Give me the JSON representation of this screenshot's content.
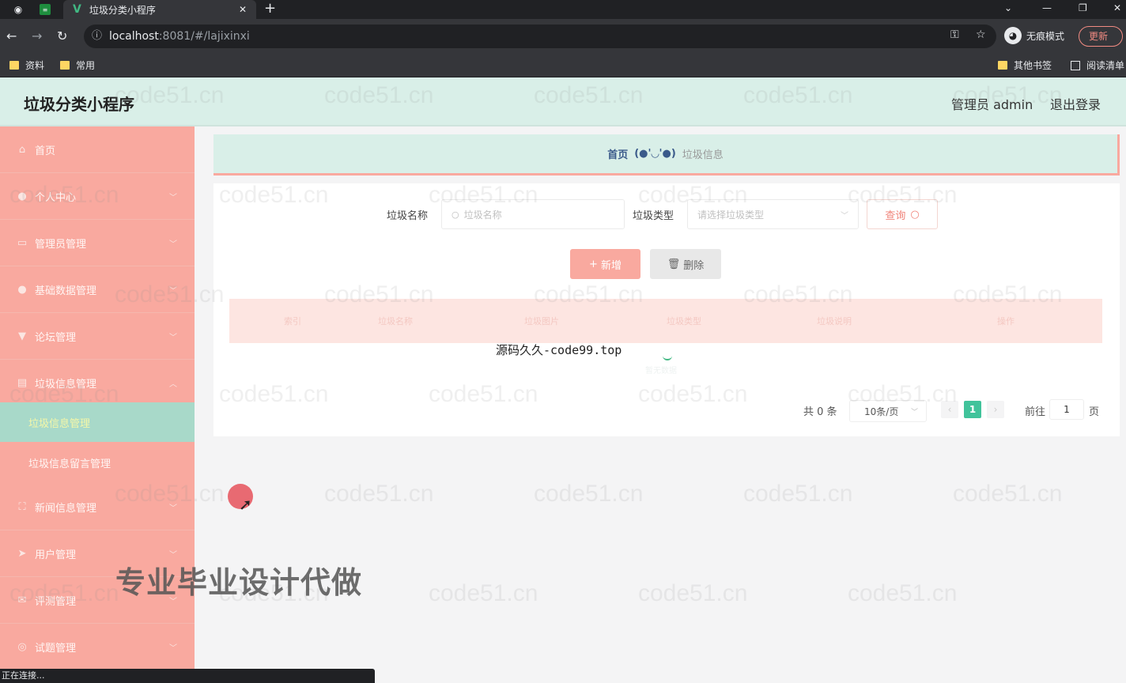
{
  "browser": {
    "tab_title": "垃圾分类小程序",
    "address_host": "localhost",
    "address_path": ":8081/#/lajixinxi",
    "incognito_label": "无痕模式",
    "update_label": "更新",
    "bookmarks": [
      "资料",
      "常用"
    ],
    "bookmarks_right": [
      "其他书签",
      "阅读清单"
    ],
    "status_text": "正在连接..."
  },
  "header": {
    "title": "垃圾分类小程序",
    "admin": "管理员 admin",
    "logout": "退出登录"
  },
  "sidebar": {
    "items": [
      {
        "label": "首页",
        "icon": "home-icon"
      },
      {
        "label": "个人中心",
        "icon": "user-icon"
      },
      {
        "label": "管理员管理",
        "icon": "card-icon"
      },
      {
        "label": "基础数据管理",
        "icon": "user-icon"
      },
      {
        "label": "论坛管理",
        "icon": "cup-icon"
      },
      {
        "label": "垃圾信息管理",
        "icon": "document-icon"
      },
      {
        "label": "新闻信息管理",
        "icon": "expand-icon"
      },
      {
        "label": "用户管理",
        "icon": "send-icon"
      },
      {
        "label": "评测管理",
        "icon": "mail-icon"
      },
      {
        "label": "试题管理",
        "icon": "globe-icon"
      }
    ],
    "sub_items": [
      "垃圾信息管理",
      "垃圾信息留言管理"
    ]
  },
  "breadcrumb": {
    "home": "首页",
    "face": "(●'◡'●)",
    "current": "垃圾信息"
  },
  "search": {
    "name_label": "垃圾名称",
    "name_placeholder": "垃圾名称",
    "type_label": "垃圾类型",
    "type_placeholder": "请选择垃圾类型",
    "query_label": "查询"
  },
  "actions": {
    "add_label": "新增",
    "delete_label": "删除"
  },
  "table": {
    "headers": [
      "",
      "索引",
      "垃圾名称",
      "垃圾图片",
      "垃圾类型",
      "垃圾说明",
      "操作"
    ],
    "empty_text": "暂无数据"
  },
  "pagination": {
    "total": "共 0 条",
    "page_size": "10条/页",
    "current_page": "1",
    "goto_label": "前往",
    "goto_value": "1",
    "page_suffix": "页"
  },
  "overlays": {
    "source_text": "源码久久-code99.top",
    "promo": "专业毕业设计代做",
    "watermark": "code51.cn"
  }
}
